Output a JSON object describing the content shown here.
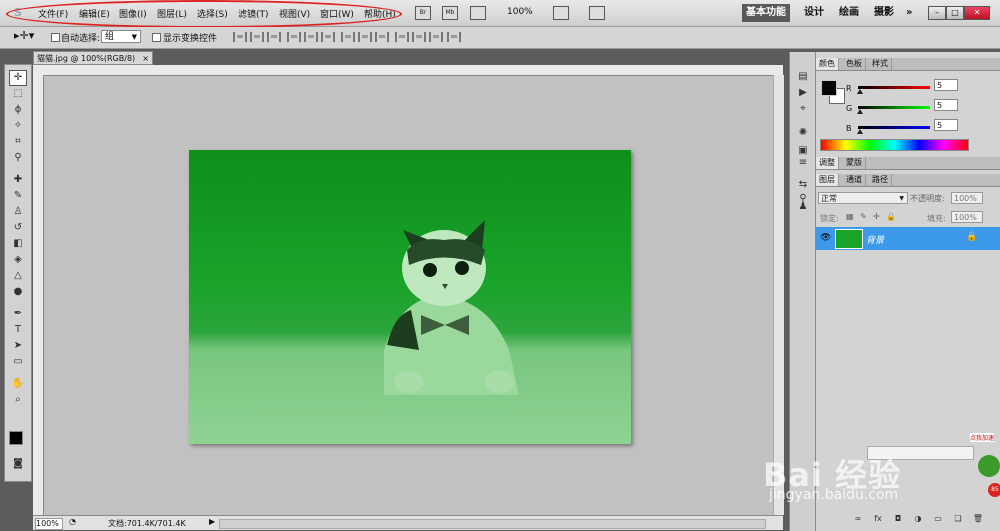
{
  "menubar": {
    "logo": "S",
    "items": [
      "文件(F)",
      "编辑(E)",
      "图像(I)",
      "图层(L)",
      "选择(S)",
      "滤镜(T)",
      "视图(V)",
      "窗口(W)",
      "帮助(H)"
    ],
    "icons": [
      "Br",
      "Mb"
    ],
    "zoom": "100%",
    "workspaces": [
      "基本功能",
      "设计",
      "绘画",
      "摄影"
    ],
    "more": "»"
  },
  "options": {
    "auto_select_label": "自动选择:",
    "auto_select_value": "组",
    "transform_label": "显示变换控件"
  },
  "document": {
    "tab_title": "猫猫.jpg @ 100%(RGB/8)",
    "close": "×",
    "zoom_status": "100%",
    "doc_info": "文档:701.4K/701.4K"
  },
  "color_panel": {
    "tabs": [
      "颜色",
      "色板",
      "样式"
    ],
    "channels": [
      {
        "label": "R",
        "value": "5",
        "color": "#c00000"
      },
      {
        "label": "G",
        "value": "5",
        "color": "#00b000"
      },
      {
        "label": "B",
        "value": "5",
        "color": "#0000c0"
      }
    ]
  },
  "adjust_panel": {
    "tabs": [
      "调整",
      "蒙版"
    ]
  },
  "layers_panel": {
    "tabs": [
      "图层",
      "通道",
      "路径"
    ],
    "blend_mode": "正常",
    "opacity_label": "不透明度:",
    "opacity_value": "100%",
    "lock_label": "锁定:",
    "fill_label": "填充:",
    "fill_value": "100%",
    "layer_name": "背景"
  },
  "watermark": {
    "brand": "Bai 经验",
    "url": "jingyan.baidu.com"
  },
  "widget": {
    "label": "点我加速",
    "badge": "85"
  }
}
